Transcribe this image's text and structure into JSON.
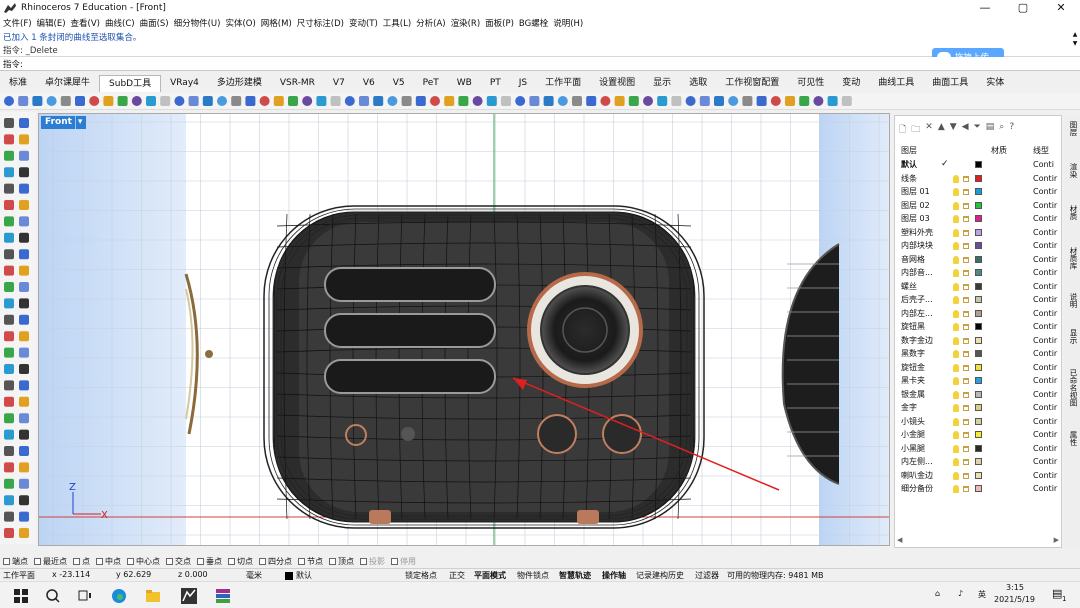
{
  "window": {
    "title": "Rhinoceros 7 Education - [Front]",
    "controls": [
      "—",
      "▢",
      "✕"
    ]
  },
  "menu": [
    "文件(F)",
    "编辑(E)",
    "查看(V)",
    "曲线(C)",
    "曲面(S)",
    "细分物件(U)",
    "实体(O)",
    "网格(M)",
    "尺寸标注(D)",
    "变动(T)",
    "工具(L)",
    "分析(A)",
    "渲染(R)",
    "面板(P)",
    "BG螺栓",
    "说明(H)"
  ],
  "command": {
    "history_line1": "已加入 1 条封闭的曲线至选取集合。",
    "history_line2": "指令: _Delete",
    "prompt_label": "指令:",
    "input_value": "",
    "upload_button": "拖拽上传"
  },
  "tabs": [
    {
      "label": "标准",
      "active": false
    },
    {
      "label": "卓尔课犀牛",
      "active": false
    },
    {
      "label": "SubD工具",
      "active": true
    },
    {
      "label": "VRay4",
      "active": false
    },
    {
      "label": "多边形建模",
      "active": false
    },
    {
      "label": "VSR-MR",
      "active": false
    },
    {
      "label": "V7",
      "active": false
    },
    {
      "label": "V6",
      "active": false
    },
    {
      "label": "V5",
      "active": false
    },
    {
      "label": "PeT",
      "active": false
    },
    {
      "label": "WB",
      "active": false
    },
    {
      "label": "PT",
      "active": false
    },
    {
      "label": "JS",
      "active": false
    },
    {
      "label": "工作平面",
      "active": false
    },
    {
      "label": "设置视图",
      "active": false
    },
    {
      "label": "显示",
      "active": false
    },
    {
      "label": "选取",
      "active": false
    },
    {
      "label": "工作视窗配置",
      "active": false
    },
    {
      "label": "可见性",
      "active": false
    },
    {
      "label": "变动",
      "active": false
    },
    {
      "label": "曲线工具",
      "active": false
    },
    {
      "label": "曲面工具",
      "active": false
    },
    {
      "label": "实体",
      "active": false
    }
  ],
  "viewport": {
    "name": "Front",
    "axis_z": "Z",
    "axis_x": "X"
  },
  "layers": {
    "columns": {
      "name": "图层",
      "material": "材质",
      "linetype": "线型"
    },
    "rows": [
      {
        "name": "默认",
        "current": true,
        "color": "#000000",
        "linetype": "Conti",
        "bold": true
      },
      {
        "name": "线条",
        "color": "#e02020",
        "linetype": "Contir"
      },
      {
        "name": "图层 01",
        "color": "#1d9be0",
        "linetype": "Contir"
      },
      {
        "name": "图层 02",
        "color": "#28c23a",
        "linetype": "Contir"
      },
      {
        "name": "图层 03",
        "color": "#e0208a",
        "linetype": "Contir"
      },
      {
        "name": "塑料外壳",
        "color": "#b9a2e6",
        "linetype": "Contir"
      },
      {
        "name": "内部块块",
        "color": "#6a4a9a",
        "linetype": "Contir"
      },
      {
        "name": "音网格",
        "color": "#3a6f6a",
        "linetype": "Contir"
      },
      {
        "name": "内部音...",
        "color": "#4f8a86",
        "linetype": "Contir"
      },
      {
        "name": "螺丝",
        "color": "#3b3b3b",
        "linetype": "Contir"
      },
      {
        "name": "后壳子...",
        "color": "#c8c8a8",
        "linetype": "Contir"
      },
      {
        "name": "内部左...",
        "color": "#b0a090",
        "linetype": "Contir"
      },
      {
        "name": "旋钮黑",
        "color": "#050505",
        "linetype": "Contir"
      },
      {
        "name": "数字金边",
        "color": "#e8e0b0",
        "linetype": "Contir"
      },
      {
        "name": "黑数字",
        "color": "#555555",
        "linetype": "Contir"
      },
      {
        "name": "旋钮金",
        "color": "#f0e23a",
        "linetype": "Contir"
      },
      {
        "name": "黑卡夹",
        "color": "#2aa0e0",
        "linetype": "Contir"
      },
      {
        "name": "银金属",
        "color": "#b8b8b8",
        "linetype": "Contir"
      },
      {
        "name": "金字",
        "color": "#d8cf88",
        "linetype": "Contir"
      },
      {
        "name": "小镜头",
        "color": "#d8d0a0",
        "linetype": "Contir"
      },
      {
        "name": "小金腿",
        "color": "#f4ee30",
        "linetype": "Contir"
      },
      {
        "name": "小黑腿",
        "color": "#2a2a2a",
        "linetype": "Contir"
      },
      {
        "name": "内左侧...",
        "color": "#e0d0b0",
        "linetype": "Contir"
      },
      {
        "name": "喇叭金边",
        "color": "#e8e0b0",
        "linetype": "Contir"
      },
      {
        "name": "细分备份",
        "color": "#f0b8b8",
        "linetype": "Contir"
      }
    ]
  },
  "side_tabs": [
    "图层",
    "渲染",
    "材质",
    "材质库",
    "说明",
    "显示",
    "已命名视图",
    "属性"
  ],
  "osnap": [
    {
      "label": "端点",
      "enabled": true
    },
    {
      "label": "最近点",
      "enabled": true
    },
    {
      "label": "点",
      "enabled": true
    },
    {
      "label": "中点",
      "enabled": true
    },
    {
      "label": "中心点",
      "enabled": true
    },
    {
      "label": "交点",
      "enabled": true
    },
    {
      "label": "垂点",
      "enabled": true
    },
    {
      "label": "切点",
      "enabled": true
    },
    {
      "label": "四分点",
      "enabled": true
    },
    {
      "label": "节点",
      "enabled": true
    },
    {
      "label": "顶点",
      "enabled": true
    },
    {
      "label": "投影",
      "enabled": false
    },
    {
      "label": "停用",
      "enabled": false
    }
  ],
  "status": {
    "cplane": "工作平面",
    "x": "x -23.114",
    "y": "y 62.629",
    "z": "z 0.000",
    "unit": "毫米",
    "layer": "默认",
    "grid_snap": "锁定格点",
    "ortho": "正交",
    "planar": "平面模式",
    "osnap": "物件锁点",
    "smarttrack": "智慧轨迹",
    "gumball": "操作轴",
    "history": "记录建构历史",
    "filter": "过滤器",
    "memory": "可用的物理内存: 9481 MB"
  },
  "taskbar": {
    "time": "3:15",
    "date": "2021/5/19",
    "ime": "英",
    "notifications": "1"
  }
}
